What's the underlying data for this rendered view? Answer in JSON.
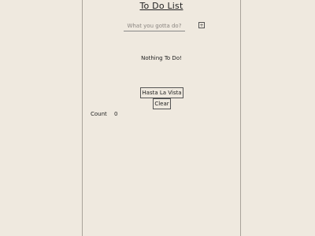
{
  "header": {
    "title": "To Do List"
  },
  "form": {
    "input_placeholder": "What you gotta do?",
    "input_value": "",
    "add_label": "+"
  },
  "list": {
    "empty_message": "Nothing To Do!"
  },
  "actions": {
    "hasta_label": "Hasta La Vista",
    "clear_label": "Clear"
  },
  "footer": {
    "count_label": "Count",
    "count_value": "0"
  }
}
